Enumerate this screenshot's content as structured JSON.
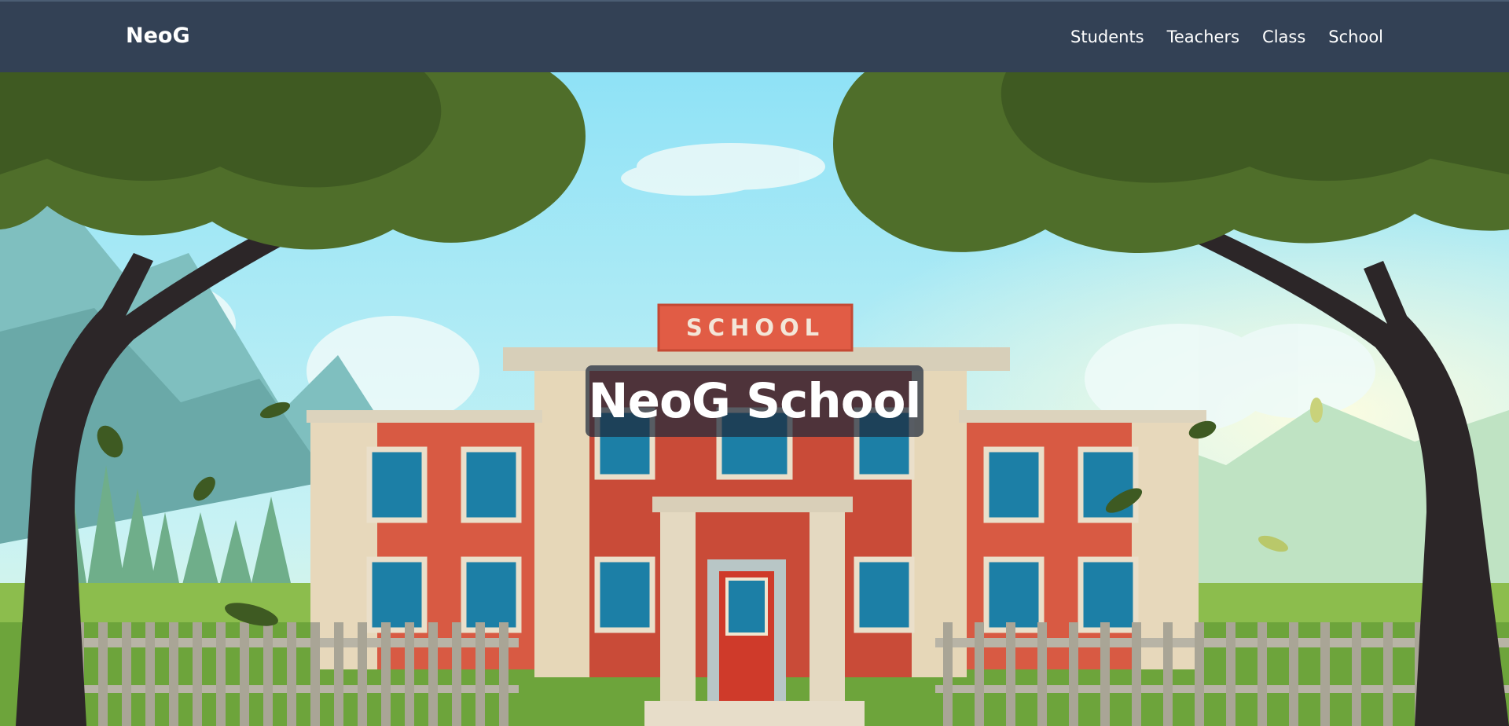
{
  "navbar": {
    "brand": "NeoG",
    "links": [
      {
        "label": "Students"
      },
      {
        "label": "Teachers"
      },
      {
        "label": "Class"
      },
      {
        "label": "School"
      }
    ]
  },
  "hero": {
    "title": "NeoG School",
    "sign_text": "SCHOOL"
  },
  "colors": {
    "navbar_bg": "#334155",
    "title_box_bg": "#1e293b",
    "brick": "#d9533f",
    "sky": "#a8e6f5"
  }
}
